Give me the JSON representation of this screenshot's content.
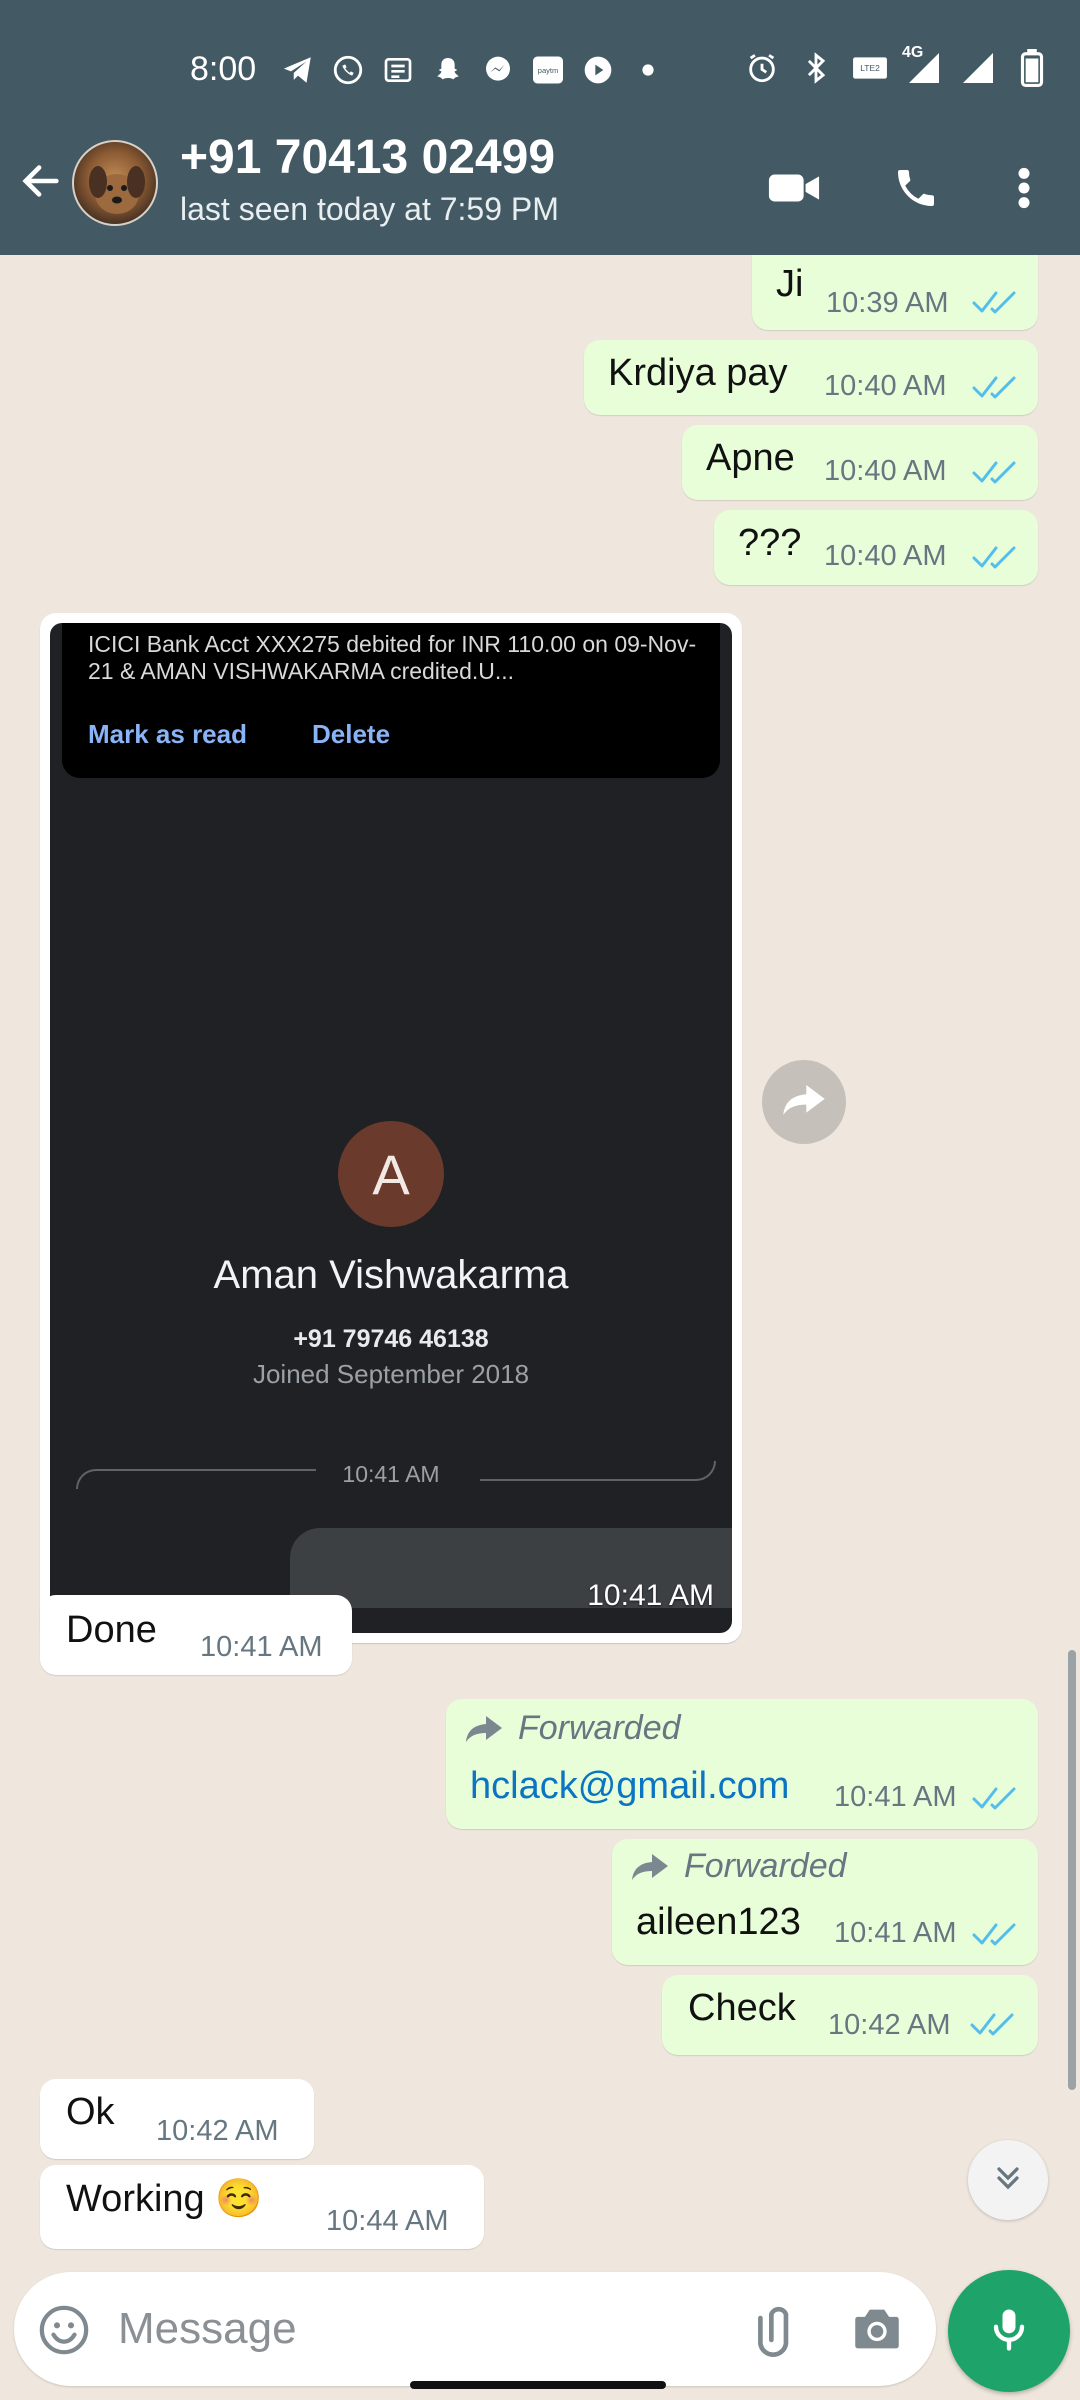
{
  "status_bar": {
    "time": "8:00",
    "network": "4G"
  },
  "header": {
    "contact_name": "+91 70413 02499",
    "last_seen": "last seen today at 7:59 PM"
  },
  "messages": [
    {
      "direction": "out",
      "text": "Ji",
      "time": "10:39 AM",
      "read": true
    },
    {
      "direction": "out",
      "text": "Krdiya pay",
      "time": "10:40 AM",
      "read": true
    },
    {
      "direction": "out",
      "text": "Apne",
      "time": "10:40 AM",
      "read": true
    },
    {
      "direction": "out",
      "text": "???",
      "time": "10:40 AM",
      "read": true
    },
    {
      "direction": "in",
      "type": "image",
      "time": "10:41 AM"
    },
    {
      "direction": "in",
      "text": "Done",
      "time": "10:41 AM"
    },
    {
      "direction": "out",
      "forwarded": true,
      "forwarded_label": "Forwarded",
      "text": "hclack@gmail.com",
      "time": "10:41 AM",
      "read": true
    },
    {
      "direction": "out",
      "forwarded": true,
      "forwarded_label": "Forwarded",
      "text": "aileen123",
      "time": "10:41 AM",
      "read": true
    },
    {
      "direction": "out",
      "text": "Check",
      "time": "10:42 AM",
      "read": true
    },
    {
      "direction": "in",
      "text": "Ok",
      "time": "10:42 AM"
    },
    {
      "direction": "in",
      "text": "Working ☺️",
      "time": "10:44 AM"
    }
  ],
  "image_message": {
    "notification_text": "ICICI Bank Acct XXX275 debited for INR 110.00 on 09-Nov-21 & AMAN VISHWAKARMA credited.U...",
    "notification_actions": [
      "Mark as read",
      "Delete"
    ],
    "payee_initial": "A",
    "payee_name": "Aman Vishwakarma",
    "payee_phone": "+91 79746 46138",
    "payee_joined": "Joined September 2018",
    "payment_time": "10:41 AM",
    "image_time": "10:41 AM"
  },
  "composer": {
    "placeholder": "Message"
  },
  "colors": {
    "header_bg": "#435a64",
    "outgoing_bubble": "#e7fed9",
    "incoming_bubble": "#ffffff",
    "read_tick": "#53bdeb",
    "mic_button": "#1ea36b",
    "chat_bg": "#efe7de"
  }
}
